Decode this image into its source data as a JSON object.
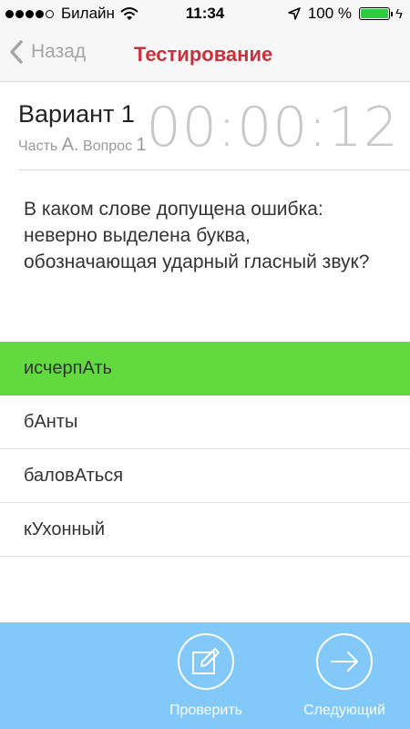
{
  "status_bar": {
    "carrier": "Билайн",
    "time": "11:34",
    "battery_percent": "100 %",
    "signal_filled": 4,
    "signal_total": 5
  },
  "nav": {
    "back_label": "Назад",
    "title": "Тестирование"
  },
  "header": {
    "variant": "Вариант 1",
    "part_prefix": "Часть",
    "part_letter": "А.",
    "question_prefix": "Вопрос",
    "question_number": "1",
    "timer": "00:00:12"
  },
  "question": {
    "text": "В каком слове допущена ошибка: неверно выделена буква, обозначающая ударный гласный звук?"
  },
  "answers": [
    {
      "label": "исчерпАть",
      "selected": true
    },
    {
      "label": "бАнты",
      "selected": false
    },
    {
      "label": "баловАться",
      "selected": false
    },
    {
      "label": "кУхонный",
      "selected": false
    }
  ],
  "bottom_bar": {
    "check_label": "Проверить",
    "next_label": "Следующий"
  },
  "colors": {
    "accent_red": "#c9303c",
    "selected_green": "#62d93e",
    "bottom_blue": "#82c8f8"
  }
}
